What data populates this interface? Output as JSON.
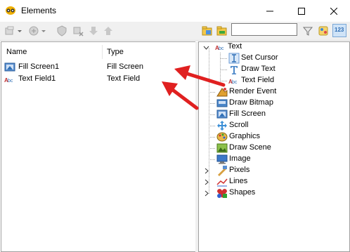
{
  "window": {
    "title": "Elements",
    "icon": "cat-mask-icon",
    "controls": [
      "minimize-icon",
      "maximize-icon",
      "close-icon"
    ]
  },
  "toolbar_right": {
    "search_value": "",
    "zoom_label": "123"
  },
  "elements_table": {
    "headers": {
      "name": "Name",
      "type": "Type"
    },
    "rows": [
      {
        "name": "Fill Screen1",
        "type": "Fill Screen",
        "icon": "fill-screen-icon"
      },
      {
        "name": "Text Field1",
        "type": "Text Field",
        "icon": "text-field-icon"
      }
    ]
  },
  "tree": {
    "text_group": "Text",
    "text_children": [
      "Set Cursor",
      "Draw Text",
      "Text Field"
    ],
    "nodes": [
      "Render Event",
      "Draw Bitmap",
      "Fill Screen",
      "Scroll",
      "Graphics",
      "Draw Scene",
      "Image",
      "Pixels",
      "Lines",
      "Shapes"
    ]
  },
  "colors": {
    "arrow": "#e02020",
    "accent": "#2e7bd6"
  }
}
